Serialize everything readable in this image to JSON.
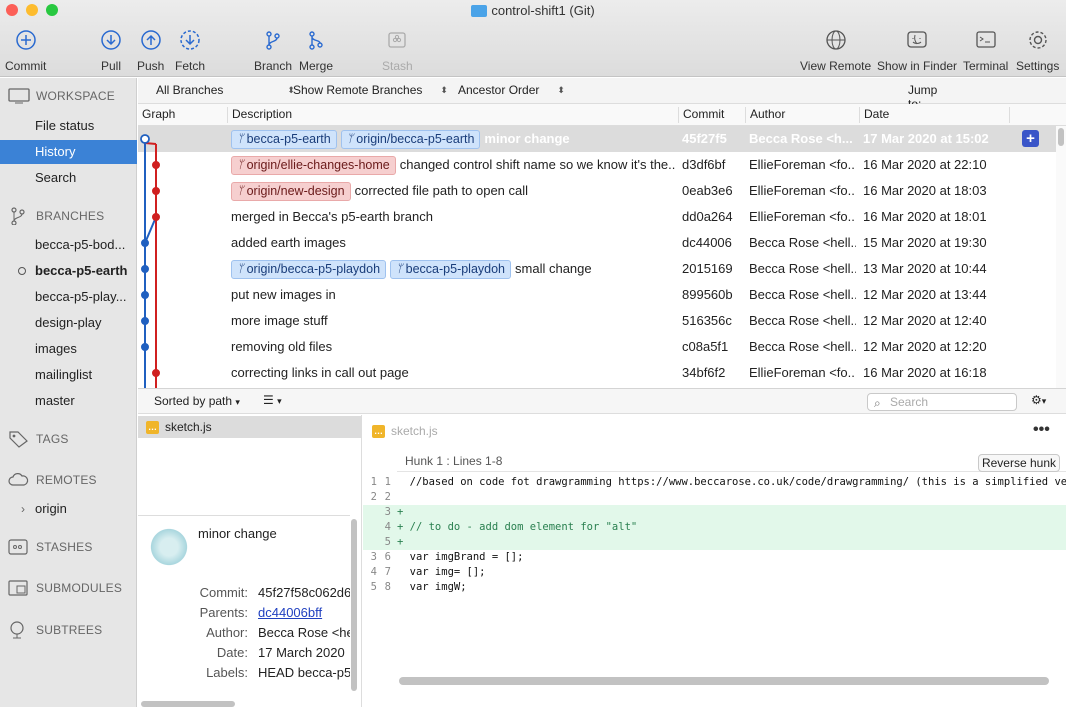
{
  "window": {
    "title": "control-shift1 (Git)"
  },
  "colors": {
    "accent": "#3b82d6",
    "close": "#fc5f57",
    "min": "#fdbc2e",
    "max": "#28c840",
    "graph_blue": "#2060c0",
    "graph_red": "#d02020"
  },
  "toolbar": {
    "commit": "Commit",
    "pull": "Pull",
    "push": "Push",
    "fetch": "Fetch",
    "branch": "Branch",
    "merge": "Merge",
    "stash": "Stash",
    "view_remote": "View Remote",
    "show_in_finder": "Show in Finder",
    "terminal": "Terminal",
    "settings": "Settings"
  },
  "sidebar": {
    "workspace": "WORKSPACE",
    "file_status": "File status",
    "history": "History",
    "search": "Search",
    "branches_header": "BRANCHES",
    "branches": [
      "becca-p5-bod...",
      "becca-p5-earth",
      "becca-p5-play...",
      "design-play",
      "images",
      "mailinglist",
      "master"
    ],
    "tags": "TAGS",
    "remotes": "REMOTES",
    "origin": "origin",
    "stashes": "STASHES",
    "submodules": "SUBMODULES",
    "subtrees": "SUBTREES"
  },
  "filters": {
    "branches": "All Branches",
    "remote": "Show Remote Branches",
    "order": "Ancestor Order",
    "jump": "Jump to:"
  },
  "columns": {
    "graph": "Graph",
    "description": "Description",
    "commit": "Commit",
    "author": "Author",
    "date": "Date"
  },
  "commits": [
    {
      "tags": [
        {
          "text": "becca-p5-earth",
          "color": "blue"
        },
        {
          "text": "origin/becca-p5-earth",
          "color": "blue"
        }
      ],
      "message": "minor change",
      "hash": "45f27f5",
      "author": "Becca Rose <h...",
      "date": "17 Mar 2020 at 15:02"
    },
    {
      "tags": [
        {
          "text": "origin/ellie-changes-home",
          "color": "red"
        }
      ],
      "message": "changed control shift name so we know it's the...",
      "hash": "d3df6bf",
      "author": "EllieForeman <fo...",
      "date": "16 Mar 2020 at 22:10"
    },
    {
      "tags": [
        {
          "text": "origin/new-design",
          "color": "red"
        }
      ],
      "message": "corrected file path to open call",
      "hash": "0eab3e6",
      "author": "EllieForeman <fo...",
      "date": "16 Mar 2020 at 18:03"
    },
    {
      "tags": [],
      "message": "merged in Becca's p5-earth branch",
      "hash": "dd0a264",
      "author": "EllieForeman <fo...",
      "date": "16 Mar 2020 at 18:01"
    },
    {
      "tags": [],
      "message": "added earth images",
      "hash": "dc44006",
      "author": "Becca Rose <hell...",
      "date": "15 Mar 2020 at 19:30"
    },
    {
      "tags": [
        {
          "text": "origin/becca-p5-playdoh",
          "color": "blue"
        },
        {
          "text": "becca-p5-playdoh",
          "color": "blue"
        }
      ],
      "message": "small change",
      "hash": "2015169",
      "author": "Becca Rose <hell...",
      "date": "13 Mar 2020 at 10:44"
    },
    {
      "tags": [],
      "message": "put new images in",
      "hash": "899560b",
      "author": "Becca Rose <hell...",
      "date": "12 Mar 2020 at 13:44"
    },
    {
      "tags": [],
      "message": "more image stuff",
      "hash": "516356c",
      "author": "Becca Rose <hell...",
      "date": "12 Mar 2020 at 12:40"
    },
    {
      "tags": [],
      "message": "removing old files",
      "hash": "c08a5f1",
      "author": "Becca Rose <hell...",
      "date": "12 Mar 2020 at 12:20"
    },
    {
      "tags": [],
      "message": "correcting links in call out page",
      "hash": "34bf6f2",
      "author": "EllieForeman <fo...",
      "date": "16 Mar 2020 at 16:18"
    }
  ],
  "lower": {
    "sorted": "Sorted by path",
    "search_placeholder": "Search"
  },
  "files": {
    "name": "sketch.js"
  },
  "details": {
    "message": "minor change",
    "commit_label": "Commit:",
    "commit": "45f27f58c062d6",
    "parents_label": "Parents:",
    "parents": "dc44006bff",
    "author_label": "Author:",
    "author": "Becca Rose <he",
    "date_label": "Date:",
    "date": "17 March 2020",
    "labels_label": "Labels:",
    "labels": "HEAD becca-p5"
  },
  "diff": {
    "file": "sketch.js",
    "hunk": "Hunk 1 : Lines 1-8",
    "reverse": "Reverse hunk",
    "lines": [
      {
        "a": "1",
        "b": "1",
        "t": "  //based on code fot drawgramming https://www.beccarose.co.uk/code/drawgramming/ (this is a simplified version",
        "add": false
      },
      {
        "a": "2",
        "b": "2",
        "t": "",
        "add": false
      },
      {
        "a": "",
        "b": "3",
        "t": "+",
        "add": true
      },
      {
        "a": "",
        "b": "4",
        "t": "+ // to do - add dom element for \"alt\"",
        "add": true
      },
      {
        "a": "",
        "b": "5",
        "t": "+",
        "add": true
      },
      {
        "a": "3",
        "b": "6",
        "t": "  var imgBrand = [];",
        "add": false
      },
      {
        "a": "4",
        "b": "7",
        "t": "  var img= [];",
        "add": false
      },
      {
        "a": "5",
        "b": "8",
        "t": "  var imgW;",
        "add": false
      }
    ]
  }
}
